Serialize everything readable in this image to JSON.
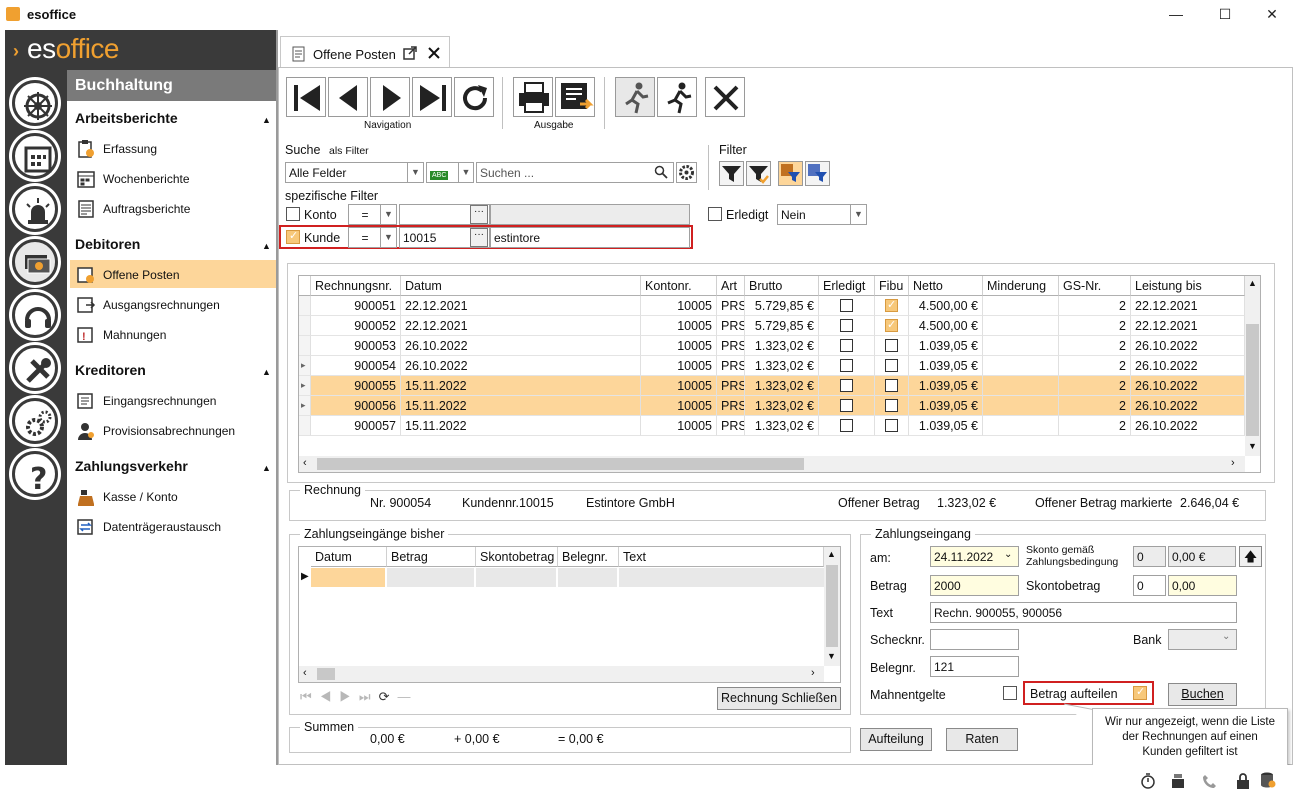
{
  "window": {
    "title": "esoffice",
    "minimize": "—",
    "maximize": "☐",
    "close": "✕"
  },
  "brand": {
    "es": "es",
    "office": "office"
  },
  "nav": {
    "header": "Buchhaltung",
    "sections": [
      {
        "title": "Arbeitsberichte",
        "items": [
          "Erfassung",
          "Wochenberichte",
          "Auftragsberichte"
        ]
      },
      {
        "title": "Debitoren",
        "items": [
          "Offene Posten",
          "Ausgangsrechnungen",
          "Mahnungen"
        ]
      },
      {
        "title": "Kreditoren",
        "items": [
          "Eingangsrechnungen",
          "Provisionsabrechnungen"
        ]
      },
      {
        "title": "Zahlungsverkehr",
        "items": [
          "Kasse / Konto",
          "Datenträgeraustausch"
        ]
      }
    ],
    "active_item": "Offene Posten"
  },
  "tab": {
    "label": "Offene Posten"
  },
  "toolbar": {
    "navigation_label": "Navigation",
    "ausgabe_label": "Ausgabe"
  },
  "search": {
    "label": "Suche",
    "as_filter": "als Filter",
    "field": "Alle Felder",
    "placeholder": "Suchen ...",
    "filter_label": "Filter",
    "spec_filter_label": "spezifische Filter"
  },
  "filters": {
    "konto": {
      "label": "Konto",
      "checked": false,
      "op": "=",
      "value": "",
      "name": ""
    },
    "kunde": {
      "label": "Kunde",
      "checked": true,
      "op": "=",
      "value": "10015",
      "name": "estintore"
    },
    "erledigt": {
      "label": "Erledigt",
      "value": "Nein"
    }
  },
  "grid": {
    "columns": [
      "Rechnungsnr.",
      "Datum",
      "Kontonr.",
      "Art",
      "Brutto",
      "Erledigt",
      "Fibu",
      "Netto",
      "Minderung",
      "GS-Nr.",
      "Leistung bis"
    ],
    "rows": [
      {
        "nr": "900051",
        "datum": "22.12.2021",
        "konto": "10005",
        "art": "PRS",
        "brutto": "5.729,85 €",
        "erledigt": false,
        "fibu": true,
        "netto": "4.500,00 €",
        "minderung": "",
        "gs": "2",
        "leistung": "22.12.2021",
        "hl": false,
        "marker": ""
      },
      {
        "nr": "900052",
        "datum": "22.12.2021",
        "konto": "10005",
        "art": "PRS",
        "brutto": "5.729,85 €",
        "erledigt": false,
        "fibu": true,
        "netto": "4.500,00 €",
        "minderung": "",
        "gs": "2",
        "leistung": "22.12.2021",
        "hl": false,
        "marker": ""
      },
      {
        "nr": "900053",
        "datum": "26.10.2022",
        "konto": "10005",
        "art": "PRS",
        "brutto": "1.323,02 €",
        "erledigt": false,
        "fibu": false,
        "netto": "1.039,05 €",
        "minderung": "",
        "gs": "2",
        "leistung": "26.10.2022",
        "hl": false,
        "marker": ""
      },
      {
        "nr": "900054",
        "datum": "26.10.2022",
        "konto": "10005",
        "art": "PRS",
        "brutto": "1.323,02 €",
        "erledigt": false,
        "fibu": false,
        "netto": "1.039,05 €",
        "minderung": "",
        "gs": "2",
        "leistung": "26.10.2022",
        "hl": false,
        "marker": "▸"
      },
      {
        "nr": "900055",
        "datum": "15.11.2022",
        "konto": "10005",
        "art": "PRS",
        "brutto": "1.323,02 €",
        "erledigt": false,
        "fibu": false,
        "netto": "1.039,05 €",
        "minderung": "",
        "gs": "2",
        "leistung": "26.10.2022",
        "hl": true,
        "marker": "▸"
      },
      {
        "nr": "900056",
        "datum": "15.11.2022",
        "konto": "10005",
        "art": "PRS",
        "brutto": "1.323,02 €",
        "erledigt": false,
        "fibu": false,
        "netto": "1.039,05 €",
        "minderung": "",
        "gs": "2",
        "leistung": "26.10.2022",
        "hl": true,
        "marker": "▸"
      },
      {
        "nr": "900057",
        "datum": "15.11.2022",
        "konto": "10005",
        "art": "PRS",
        "brutto": "1.323,02 €",
        "erledigt": false,
        "fibu": false,
        "netto": "1.039,05 €",
        "minderung": "",
        "gs": "2",
        "leistung": "26.10.2022",
        "hl": false,
        "marker": ""
      }
    ]
  },
  "rechnung": {
    "legend": "Rechnung",
    "nr": "Nr.  900054",
    "kundennr": "Kundennr.10015",
    "kunde": "Estintore GmbH",
    "offener_label": "Offener Betrag",
    "offener_value": "1.323,02 €",
    "markierte_label": "Offener Betrag markierte",
    "markierte_value": "2.646,04 €"
  },
  "eingaenge": {
    "legend": "Zahlungseingänge bisher",
    "columns": [
      "Datum",
      "Betrag",
      "Skontobetrag",
      "Belegnr.",
      "Text"
    ],
    "close_button": "Rechnung Schließen"
  },
  "summen": {
    "legend": "Summen",
    "a": "0,00 €",
    "b": "+ 0,00 €",
    "c": "= 0,00 €"
  },
  "zahlung": {
    "legend": "Zahlungseingang",
    "am_label": "am:",
    "am_value": "24.11.2022",
    "skonto_label_1": "Skonto gemäß",
    "skonto_label_2": "Zahlungsbedingung",
    "skonto_pct": "0",
    "skonto_amount": "0,00 €",
    "betrag_label": "Betrag",
    "betrag_value": "2000",
    "skontobetrag_label": "Skontobetrag",
    "skontobetrag_pct": "0",
    "skontobetrag_value": "0,00",
    "text_label": "Text",
    "text_value": "Rechn. 900055, 900056",
    "scheck_label": "Schecknr.",
    "scheck_value": "",
    "bank_label": "Bank",
    "bank_value": "",
    "beleg_label": "Belegnr.",
    "beleg_value": "121",
    "mahn_label": "Mahnentgelte",
    "aufteilen_label": "Betrag aufteilen",
    "buchen": "Buchen"
  },
  "bottom_buttons": {
    "aufteilung": "Aufteilung",
    "raten": "Raten"
  },
  "tooltip": {
    "text_1": "Wir nur angezeigt, wenn die Liste",
    "text_2": "der Rechnungen auf einen",
    "text_3": "Kunden gefiltert ist"
  },
  "colors": {
    "accent": "#f0a030",
    "highlight": "#fdd69a",
    "dark": "#3a3a3a",
    "red_outline": "#d02020"
  }
}
